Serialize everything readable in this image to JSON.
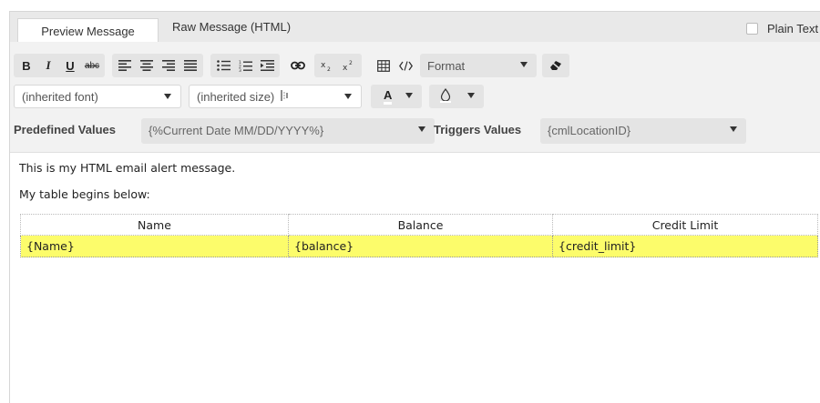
{
  "tabs": {
    "preview": "Preview Message",
    "raw": "Raw Message (HTML)",
    "plain_text": "Plain Text"
  },
  "toolbar": {
    "bold": "B",
    "italic": "I",
    "underline": "U",
    "strike": "abc",
    "format_label": "Format",
    "font_value": "(inherited font)",
    "size_value": "(inherited size)",
    "text_color_glyph": "A",
    "predefined_label": "Predefined Values",
    "predefined_value": "{%Current Date MM/DD/YYYY%}",
    "triggers_label": "Triggers Values",
    "triggers_value": "{cmlLocationID}"
  },
  "editor": {
    "line1": "This is my HTML email alert message.",
    "line2": "My table begins below:",
    "table": {
      "headers": [
        "Name",
        "Balance",
        "Credit Limit"
      ],
      "row": [
        "{Name}",
        "{balance}",
        "{credit_limit}"
      ]
    }
  },
  "colors": {
    "highlight": "#fcfc6b",
    "toolbar_bg": "#f2f2f2"
  }
}
